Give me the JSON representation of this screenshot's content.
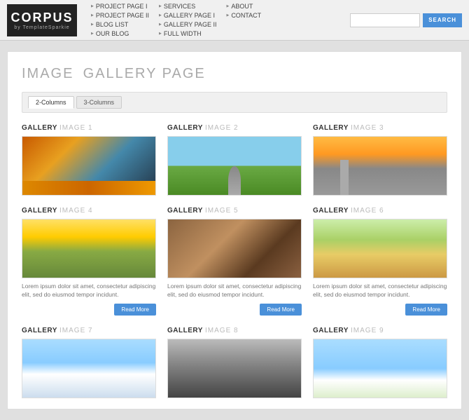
{
  "logo": {
    "title": "CORPUS",
    "subtitle": "by TemplateSparkie"
  },
  "nav": {
    "col1": [
      {
        "label": "PROJECT PAGE I"
      },
      {
        "label": "PROJECT PAGE II"
      },
      {
        "label": "BLOG LIST"
      },
      {
        "label": "OUR BLOG"
      }
    ],
    "col2": [
      {
        "label": "SERVICES"
      },
      {
        "label": "GALLERY PAGE I"
      },
      {
        "label": "GALLERY PAGE II"
      },
      {
        "label": "FULL WIDTH"
      }
    ],
    "col3": [
      {
        "label": "ABOUT"
      },
      {
        "label": "CONTACT"
      }
    ]
  },
  "search": {
    "placeholder": "",
    "button_label": "SEARCH"
  },
  "page": {
    "title": "IMAGE",
    "title_sub": "GALLERY PAGE"
  },
  "tabs": [
    {
      "label": "2-Columns",
      "active": true
    },
    {
      "label": "3-Columns",
      "active": false
    }
  ],
  "gallery_items": [
    {
      "title": "GALLERY",
      "title_sub": "IMAGE 1",
      "img_class": "img-times-square",
      "has_text": false,
      "has_btn": false
    },
    {
      "title": "GALLERY",
      "title_sub": "IMAGE 2",
      "img_class": "img-road",
      "has_text": false,
      "has_btn": false
    },
    {
      "title": "GALLERY",
      "title_sub": "IMAGE 3",
      "img_class": "img-city",
      "has_text": false,
      "has_btn": false
    },
    {
      "title": "GALLERY",
      "title_sub": "IMAGE 4",
      "img_class": "img-hills",
      "has_text": true,
      "has_btn": true,
      "text": "Lorem ipsum dolor sit amet, consectetur adipiscing elit, sed do eiusmod tempor incidunt."
    },
    {
      "title": "GALLERY",
      "title_sub": "IMAGE 5",
      "img_class": "img-engine",
      "has_text": true,
      "has_btn": true,
      "text": "Lorem ipsum dolor sit amet, consectetur adipiscing elit, sed do eiusmod tempor incidunt."
    },
    {
      "title": "GALLERY",
      "title_sub": "IMAGE 6",
      "img_class": "img-countryside",
      "has_text": true,
      "has_btn": true,
      "text": "Lorem ipsum dolor sit amet, consectetur adipiscing elit, sed do eiusmod tempor incidunt."
    },
    {
      "title": "GALLERY",
      "title_sub": "IMAGE 7",
      "img_class": "img-plane",
      "has_text": false,
      "has_btn": false
    },
    {
      "title": "GALLERY",
      "title_sub": "IMAGE 8",
      "img_class": "img-man",
      "has_text": false,
      "has_btn": false
    },
    {
      "title": "GALLERY",
      "title_sub": "IMAGE 9",
      "img_class": "img-clouds",
      "has_text": false,
      "has_btn": false
    }
  ],
  "read_more_label": "Read More"
}
